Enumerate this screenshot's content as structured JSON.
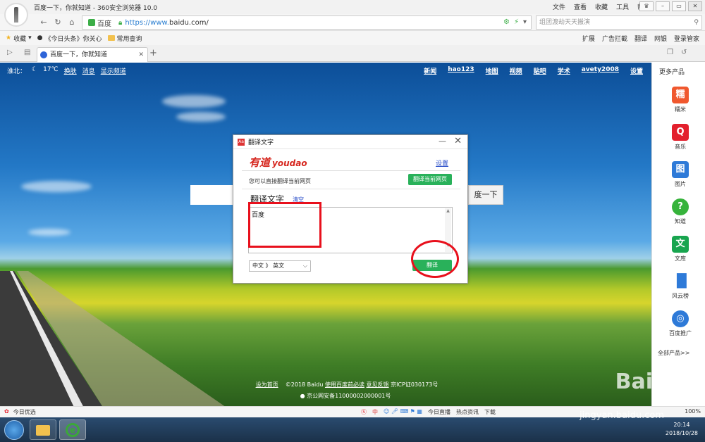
{
  "window": {
    "title": "百度一下，你就知道 - 360安全浏览器 10.0",
    "menus": [
      "文件",
      "查看",
      "收藏",
      "工具",
      "帮助"
    ]
  },
  "address": {
    "site_name": "百度",
    "url_scheme": "https://www.",
    "url_domain": "baidu.com/",
    "search_placeholder": "组团渡劫天天搬演"
  },
  "bookmarks": {
    "items": [
      "收藏",
      "《今日头条》你关心",
      "常用查询"
    ],
    "right": [
      "扩展",
      "广告拦截",
      "翻译",
      "网银",
      "登录管家"
    ]
  },
  "tabs": [
    {
      "label": "百度一下，你就知道"
    }
  ],
  "page": {
    "top_left": [
      "淮北：",
      "17℃",
      "换肤",
      "消息",
      "显示频道"
    ],
    "top_right": [
      "新闻",
      "hao123",
      "地图",
      "视频",
      "贴吧",
      "学术",
      "avety2008",
      "设置"
    ],
    "search_button": "度一下",
    "footer_line1": [
      "设为首页",
      "©2018 Baidu",
      "使用百度前必读",
      "意见反馈",
      "京ICP证030173号"
    ],
    "footer_line2": "京公网安备11000002000001号"
  },
  "sidebar": {
    "title": "更多产品",
    "items": [
      {
        "label": "糯米",
        "icon": "糯",
        "color": "#f0582e"
      },
      {
        "label": "音乐",
        "icon": "Q",
        "color": "#e3202d"
      },
      {
        "label": "图片",
        "icon": "图",
        "color": "#2e7ad8"
      },
      {
        "label": "知道",
        "icon": "?",
        "color": "#36b33b"
      },
      {
        "label": "文库",
        "icon": "文",
        "color": "#18a54f"
      },
      {
        "label": "风云榜",
        "icon": "▮",
        "color": "#2e7ad8"
      },
      {
        "label": "百度推广",
        "icon": "◎",
        "color": "#2e7ad8"
      }
    ],
    "all_products": "全部产品>>"
  },
  "dialog": {
    "title": "翻译文字",
    "logo_cn": "有道",
    "logo_en": "youdao",
    "settings": "设置",
    "hint": "您可以直接翻译当前网页",
    "translate_page_button": "翻译当前网页",
    "section_title": "翻译文字",
    "clear": "清空",
    "input_text": "百度",
    "lang_from": "中文",
    "lang_sep": "》",
    "lang_to": "英文",
    "translate_button": "翻译"
  },
  "statusbar": {
    "left": "今日优选",
    "right": [
      "中",
      "今日直播",
      "热点资讯",
      "下载"
    ],
    "zoom": "100%"
  },
  "taskbar": {
    "time": "20:14",
    "date": "2018/10/28"
  },
  "watermark": {
    "brand": "Bai经验",
    "url": "jingyan.baidu.com"
  }
}
